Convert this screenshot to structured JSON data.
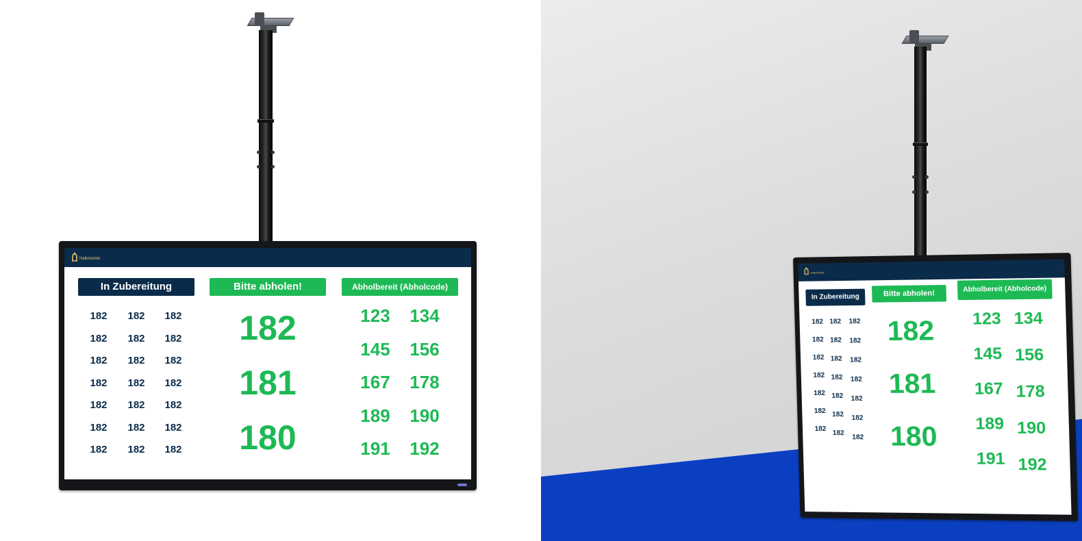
{
  "brand": {
    "logo_text": "Hallonomie",
    "logo_text_right": "Hallonomie"
  },
  "columns": {
    "preparing": {
      "title": "In Zubereitung"
    },
    "pickup": {
      "title": "Bitte abholen!"
    },
    "ready": {
      "title": "Abholbereit (Abholcode)"
    }
  },
  "preparing_numbers": [
    [
      "182",
      "182",
      "182"
    ],
    [
      "182",
      "182",
      "182"
    ],
    [
      "182",
      "182",
      "182"
    ],
    [
      "182",
      "182",
      "182"
    ],
    [
      "182",
      "182",
      "182"
    ],
    [
      "182",
      "182",
      "182"
    ],
    [
      "182",
      "182",
      "182"
    ]
  ],
  "pickup_numbers": [
    "182",
    "181",
    "180"
  ],
  "ready_numbers": [
    [
      "123",
      "134"
    ],
    [
      "145",
      "156"
    ],
    [
      "167",
      "178"
    ],
    [
      "189",
      "190"
    ],
    [
      "191",
      "192"
    ]
  ],
  "colors": {
    "navy": "#0b2b4a",
    "green": "#1db954",
    "floor_blue": "#0a3fc2",
    "wall_grey": "#dcdcdc",
    "bezel": "#141619"
  },
  "icons": {
    "logo": "crown-arch-icon",
    "led": "power-led-icon"
  }
}
